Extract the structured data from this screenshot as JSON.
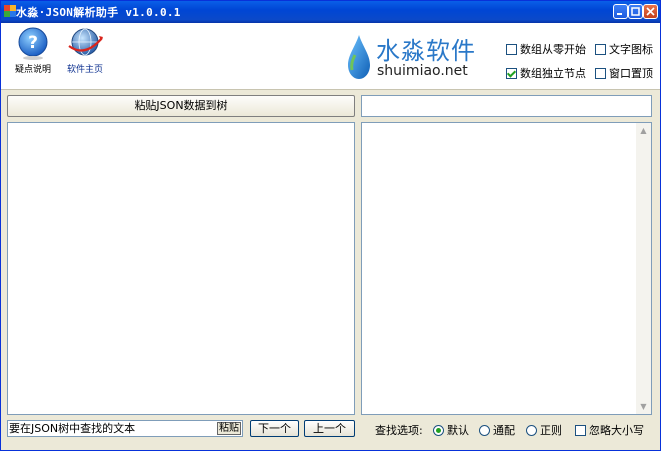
{
  "window": {
    "title": "水淼·JSON解析助手 v1.0.0.1"
  },
  "toolbar": {
    "help_label": "疑点说明",
    "home_label": "软件主页"
  },
  "brand": {
    "name_cn": "水淼软件",
    "domain": "shuimiao.net"
  },
  "options": {
    "array_from_zero": "数组从零开始",
    "text_icon": "文字图标",
    "array_independent_node": "数组独立节点",
    "window_top": "窗口置顶"
  },
  "main": {
    "paste_button": "粘贴JSON数据到树"
  },
  "search": {
    "placeholder": "要在JSON树中查找的文本",
    "paste_label": "粘贴",
    "next_label": "下一个",
    "prev_label": "上一个",
    "options_label": "查找选项:",
    "mode_default": "默认",
    "mode_wildcard": "通配",
    "mode_regex": "正则",
    "ignore_case": "忽略大小写"
  },
  "colors": {
    "titlebar": "#0054e3",
    "brand": "#2a78c8",
    "check": "#21a121"
  }
}
